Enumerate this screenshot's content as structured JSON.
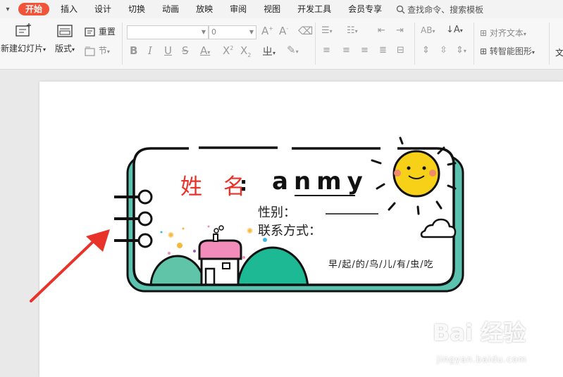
{
  "menu": {
    "tabs": [
      "开始",
      "插入",
      "设计",
      "切换",
      "动画",
      "放映",
      "审阅",
      "视图",
      "开发工具",
      "会员专享"
    ],
    "search_label": "查找命令、搜索模板"
  },
  "ribbon": {
    "new_slide": "新建幻灯片",
    "layout": "版式",
    "reset": "重置",
    "section": "节",
    "font_size": "0",
    "align_text": "对齐文本",
    "smartart": "转智能图形",
    "text_cut": "文"
  },
  "slide": {
    "name_label": "姓 名",
    "colon": ":",
    "name_value": "anmy",
    "gender_label": "性别：",
    "contact_label": "联系方式：",
    "motto": "早/起/的/鸟/儿/有/虫/吃"
  },
  "watermark": {
    "brand": "Bai  经验",
    "url": "jingyan.baidu.com"
  },
  "colors": {
    "accent": "#f0543a",
    "name_red": "#e8332a",
    "teal": "#5cc2b0",
    "sun": "#f7d117",
    "arrow": "#e8332a"
  }
}
